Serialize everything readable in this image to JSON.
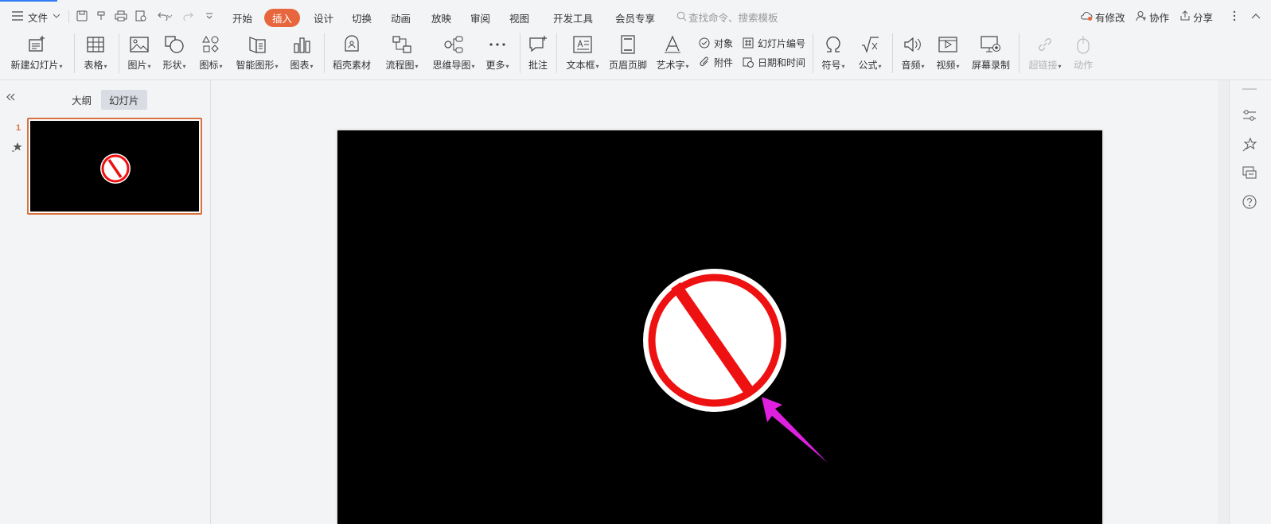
{
  "menu": {
    "file_label": "文件",
    "tabs": [
      "开始",
      "插入",
      "设计",
      "切换",
      "动画",
      "放映",
      "审阅",
      "视图",
      "开发工具",
      "会员专享"
    ],
    "active_tab": "插入",
    "search_placeholder": "查找命令、搜索模板",
    "right": {
      "changes_label": "有修改",
      "collab_label": "协作",
      "share_label": "分享"
    }
  },
  "ribbon": {
    "new_slide": "新建幻灯片",
    "table": "表格",
    "picture": "图片",
    "shape": "形状",
    "icon": "图标",
    "smartart": "智能图形",
    "chart": "图表",
    "docer_material": "稻壳素材",
    "flowchart": "流程图",
    "mindmap": "思维导图",
    "more": "更多",
    "comment": "批注",
    "textbox": "文本框",
    "header_footer": "页眉页脚",
    "wordart": "艺术字",
    "object": "对象",
    "attachment": "附件",
    "slide_number": "幻灯片编号",
    "date_time": "日期和时间",
    "symbol": "符号",
    "formula": "公式",
    "audio": "音频",
    "video": "视频",
    "screen_record": "屏幕录制",
    "hyperlink": "超链接",
    "action": "动作"
  },
  "left_panel": {
    "tab_outline": "大纲",
    "tab_slides": "幻灯片",
    "slide_number": "1"
  },
  "colors": {
    "accent": "#e8663d",
    "prohibit_red": "#ee1111",
    "arrow_magenta": "#e020e0",
    "slide_bg": "#000000"
  }
}
